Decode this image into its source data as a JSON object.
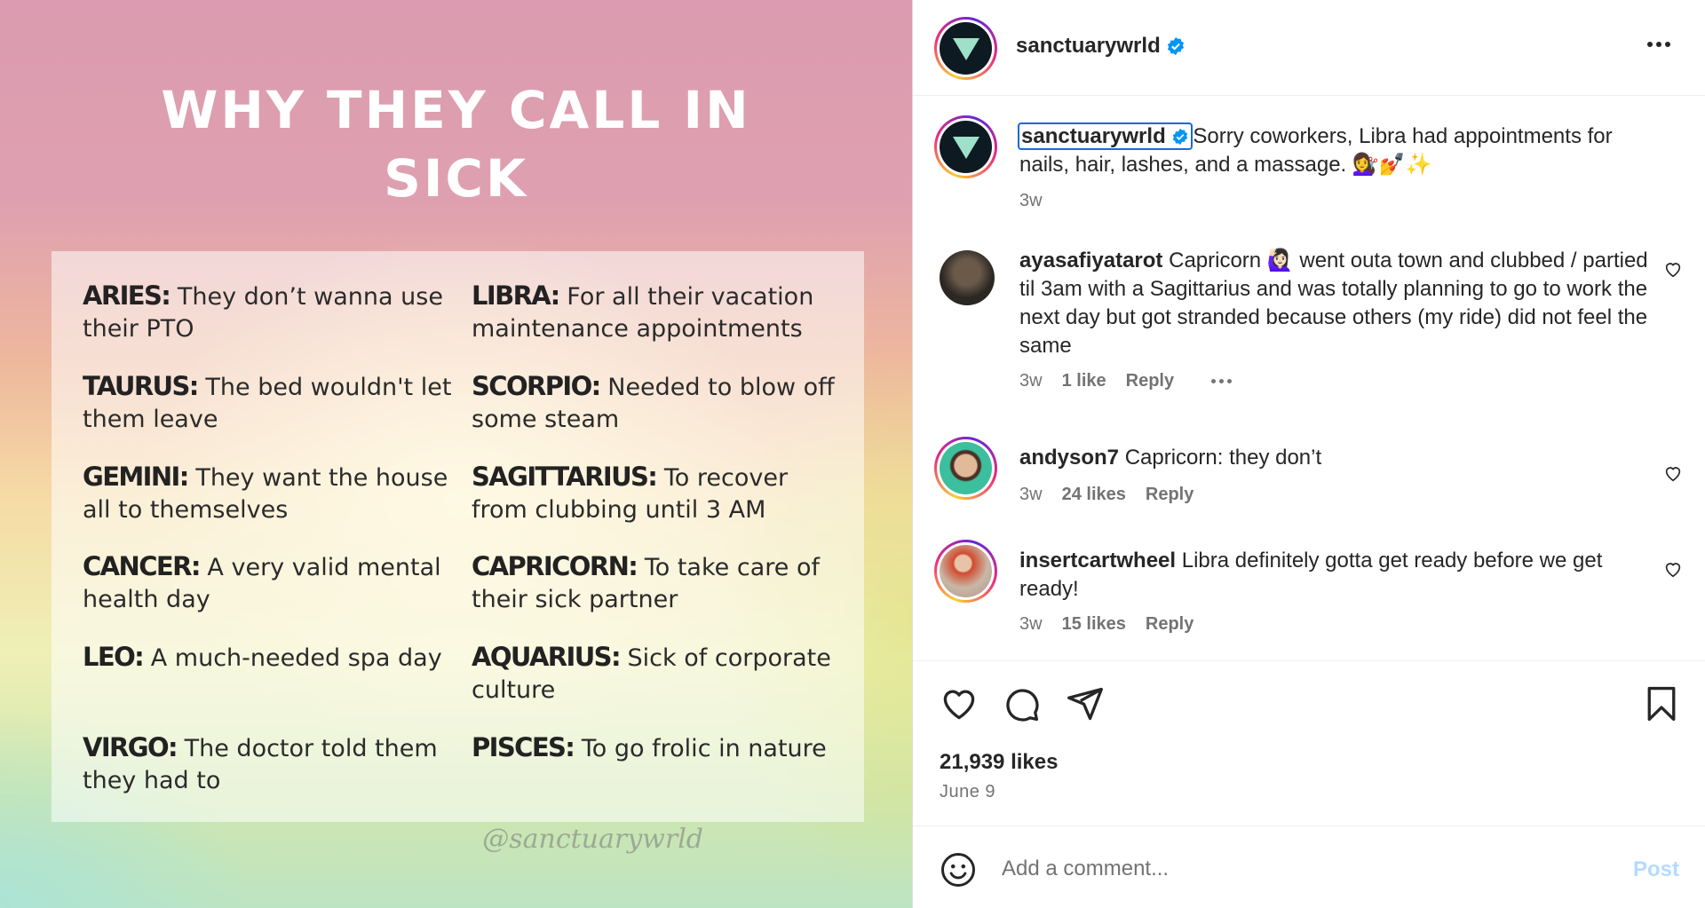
{
  "post_image": {
    "title_line1": "WHY THEY CALL IN",
    "title_line2": "SICK",
    "left_column": [
      {
        "sign": "ARIES:",
        "text": "They don’t wanna use their PTO"
      },
      {
        "sign": "TAURUS:",
        "text": "The bed wouldn't let them leave"
      },
      {
        "sign": "GEMINI:",
        "text": "They want the house all to themselves"
      },
      {
        "sign": "CANCER:",
        "text": "A very valid mental health day"
      },
      {
        "sign": "LEO:",
        "text": "A much-needed spa day"
      },
      {
        "sign": "VIRGO:",
        "text": "The doctor told them they had to"
      }
    ],
    "right_column": [
      {
        "sign": "LIBRA:",
        "text": "For all their vacation maintenance appointments"
      },
      {
        "sign": "SCORPIO:",
        "text": "Needed to blow off some steam"
      },
      {
        "sign": "SAGITTARIUS:",
        "text": "To recover from clubbing until 3 AM"
      },
      {
        "sign": "CAPRICORN:",
        "text": "To take care of their sick partner"
      },
      {
        "sign": "AQUARIUS:",
        "text": "Sick of corporate culture"
      },
      {
        "sign": "PISCES:",
        "text": "To go frolic in nature"
      }
    ],
    "watermark": "@sanctuarywrld"
  },
  "header": {
    "username": "sanctuarywrld",
    "verified_icon": "verified-badge-icon",
    "more_icon": "more-options-icon"
  },
  "caption": {
    "username": "sanctuarywrld",
    "text": "Sorry coworkers, Libra had appointments for nails, hair, lashes, and a massage. 💇‍♀️💅✨",
    "time": "3w"
  },
  "comments": [
    {
      "username": "ayasafiyatarot",
      "text": "Capricorn 🙋🏻‍♀️ went outa town and clubbed / partied til 3am with a Sagittarius and was totally planning to go to work the next day but got stranded because others (my ride) did not feel the same",
      "time": "3w",
      "likes": "1 like",
      "reply": "Reply"
    },
    {
      "username": "andyson7",
      "text": "Capricorn: they don’t",
      "time": "3w",
      "likes": "24 likes",
      "reply": "Reply"
    },
    {
      "username": "insertcartwheel",
      "text": "Libra definitely gotta get ready before we get ready!",
      "time": "3w",
      "likes": "15 likes",
      "reply": "Reply"
    }
  ],
  "actions": {
    "like_icon": "heart-icon",
    "comment_icon": "comment-icon",
    "share_icon": "share-icon",
    "save_icon": "bookmark-icon",
    "likes_count": "21,939 likes",
    "date": "June 9"
  },
  "add_comment": {
    "placeholder": "Add a comment...",
    "post_label": "Post",
    "emoji_icon": "emoji-icon"
  },
  "colors": {
    "verified": "#0095f6",
    "post_button_disabled": "#b3dbff",
    "focus_outline": "#1b6ad8"
  }
}
